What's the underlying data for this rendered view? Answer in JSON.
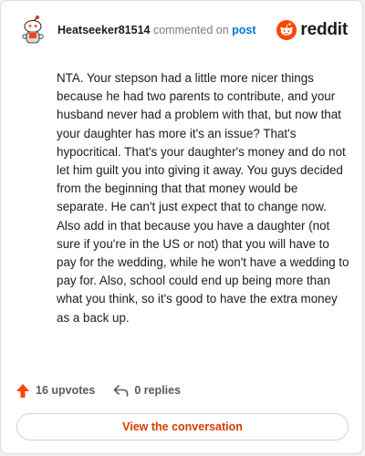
{
  "header": {
    "username": "Heatseeker81514",
    "action_text": "commented on",
    "post_link": "post",
    "brand": "reddit"
  },
  "comment": {
    "text": "NTA. Your stepson had a little more nicer things because he had two parents to contribute, and your husband never had a problem with that, but now that your daughter has more it's an issue? That's hypocritical. That's your daughter's money and do not let him guilt you into giving it away. You guys decided from the beginning that that money would be separate. He can't just expect that to change now. Also add in that because you have a daughter (not sure if you're in the US or not) that you will have to pay for the wedding, while he won't have a wedding to pay for. Also, school could end up being more than what you think, so it's good to have the extra money as a back up."
  },
  "footer": {
    "upvotes": "16 upvotes",
    "replies": "0 replies"
  },
  "cta": {
    "label": "View the conversation"
  },
  "colors": {
    "brand_orange": "#ff4500",
    "link_blue": "#0079d3",
    "cta_text": "#d93a00",
    "upvote_arrow": "#ff4500"
  },
  "icons": {
    "avatar": "snoo-avatar-icon",
    "logo": "reddit-logo-icon",
    "upvote": "upvote-arrow-icon",
    "reply": "reply-arrow-icon"
  }
}
